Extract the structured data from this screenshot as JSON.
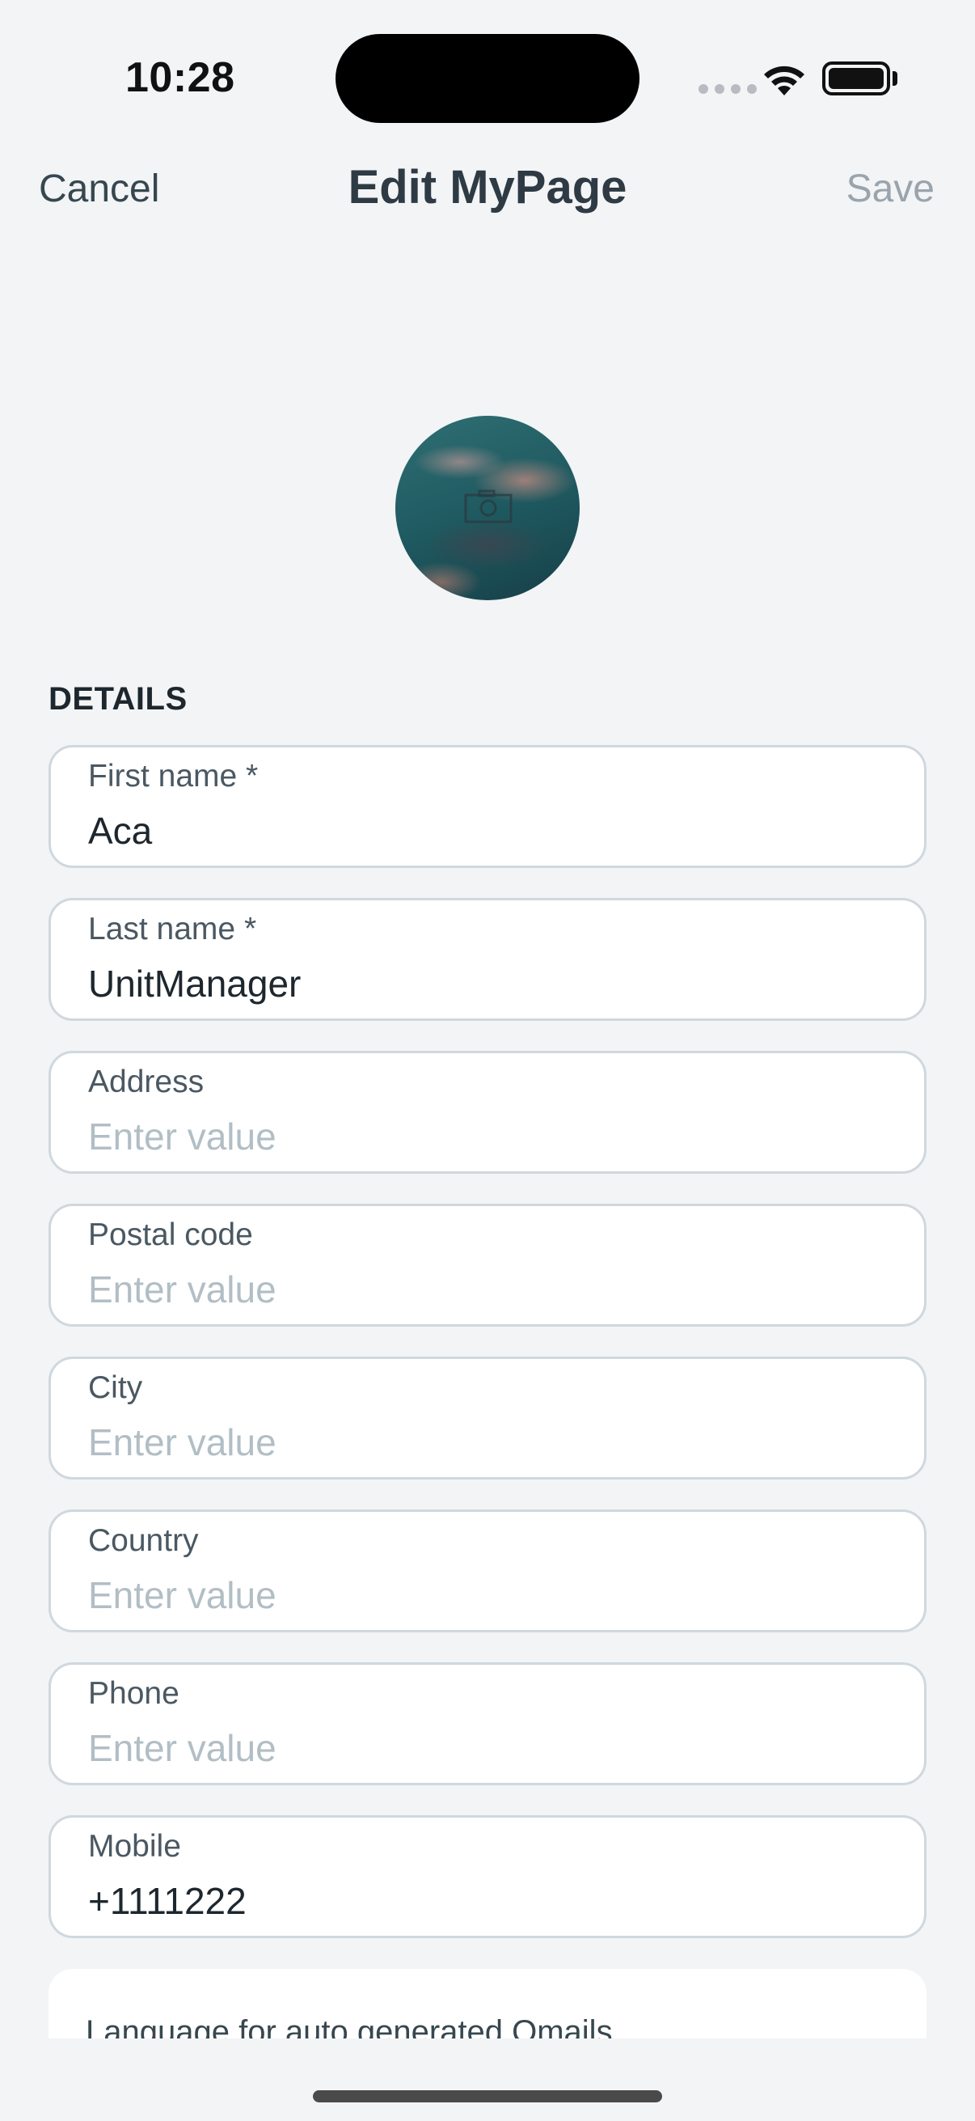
{
  "status_bar": {
    "time": "10:28"
  },
  "nav": {
    "cancel_label": "Cancel",
    "title": "Edit MyPage",
    "save_label": "Save"
  },
  "profile": {
    "avatar_icon": "camera-icon"
  },
  "details": {
    "section_title": "DETAILS",
    "fields": [
      {
        "label": "First name *",
        "value": "Aca",
        "placeholder": "Enter value"
      },
      {
        "label": "Last name *",
        "value": "UnitManager",
        "placeholder": "Enter value"
      },
      {
        "label": "Address",
        "value": "",
        "placeholder": "Enter value"
      },
      {
        "label": "Postal code",
        "value": "",
        "placeholder": "Enter value"
      },
      {
        "label": "City",
        "value": "",
        "placeholder": "Enter value"
      },
      {
        "label": "Country",
        "value": "",
        "placeholder": "Enter value"
      },
      {
        "label": "Phone",
        "value": "",
        "placeholder": "Enter value"
      },
      {
        "label": "Mobile",
        "value": "+1111222",
        "placeholder": "Enter value"
      }
    ]
  },
  "language": {
    "label": "Language for auto generated Qmails",
    "chevron_icon": "chevron-right-icon"
  },
  "colors": {
    "background": "#f2f4f6",
    "field_border": "#cfd8de",
    "placeholder": "#b2bec5",
    "save_disabled": "#9aa4ac"
  }
}
